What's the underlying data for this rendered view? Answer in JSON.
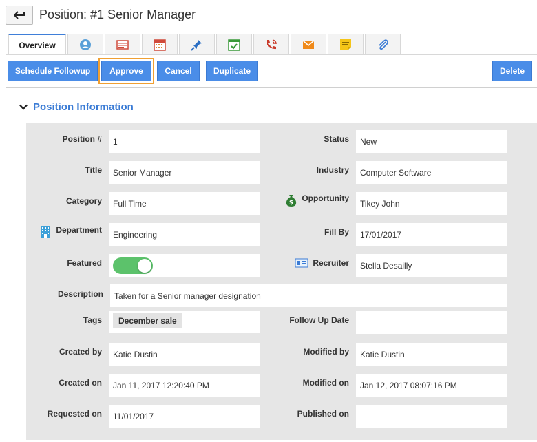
{
  "header": {
    "title": "Position: #1 Senior Manager"
  },
  "tabs": {
    "active_label": "Overview",
    "icons": [
      "contacts-icon",
      "invoice-icon",
      "calendar-icon",
      "pin-icon",
      "task-icon",
      "call-icon",
      "email-icon",
      "note-icon",
      "attachment-icon"
    ]
  },
  "actions": {
    "schedule_followup": "Schedule Followup",
    "approve": "Approve",
    "cancel": "Cancel",
    "duplicate": "Duplicate",
    "delete": "Delete"
  },
  "section": {
    "title": "Position Information"
  },
  "fields": {
    "position_no": {
      "label": "Position #",
      "value": "1"
    },
    "status": {
      "label": "Status",
      "value": "New"
    },
    "title": {
      "label": "Title",
      "value": "Senior Manager"
    },
    "industry": {
      "label": "Industry",
      "value": "Computer Software"
    },
    "category": {
      "label": "Category",
      "value": "Full Time"
    },
    "opportunity": {
      "label": "Opportunity",
      "value": "Tikey John"
    },
    "department": {
      "label": "Department",
      "value": "Engineering"
    },
    "fill_by": {
      "label": "Fill By",
      "value": "17/01/2017"
    },
    "featured": {
      "label": "Featured",
      "value": true
    },
    "recruiter": {
      "label": "Recruiter",
      "value": "Stella Desailly"
    },
    "description": {
      "label": "Description",
      "value": "Taken for a Senior manager designation"
    },
    "tags": {
      "label": "Tags",
      "value": "December sale"
    },
    "follow_up_date": {
      "label": "Follow Up Date",
      "value": ""
    },
    "created_by": {
      "label": "Created by",
      "value": "Katie Dustin"
    },
    "modified_by": {
      "label": "Modified by",
      "value": "Katie Dustin"
    },
    "created_on": {
      "label": "Created on",
      "value": "Jan 11, 2017 12:20:40 PM"
    },
    "modified_on": {
      "label": "Modified on",
      "value": "Jan 12, 2017 08:07:16 PM"
    },
    "requested_on": {
      "label": "Requested on",
      "value": "11/01/2017"
    },
    "published_on": {
      "label": "Published on",
      "value": ""
    }
  },
  "colors": {
    "accent": "#4a8de8",
    "focus_outline": "#f0a033",
    "toggle_on": "#5cc26b",
    "section_title": "#3a7bd5"
  }
}
